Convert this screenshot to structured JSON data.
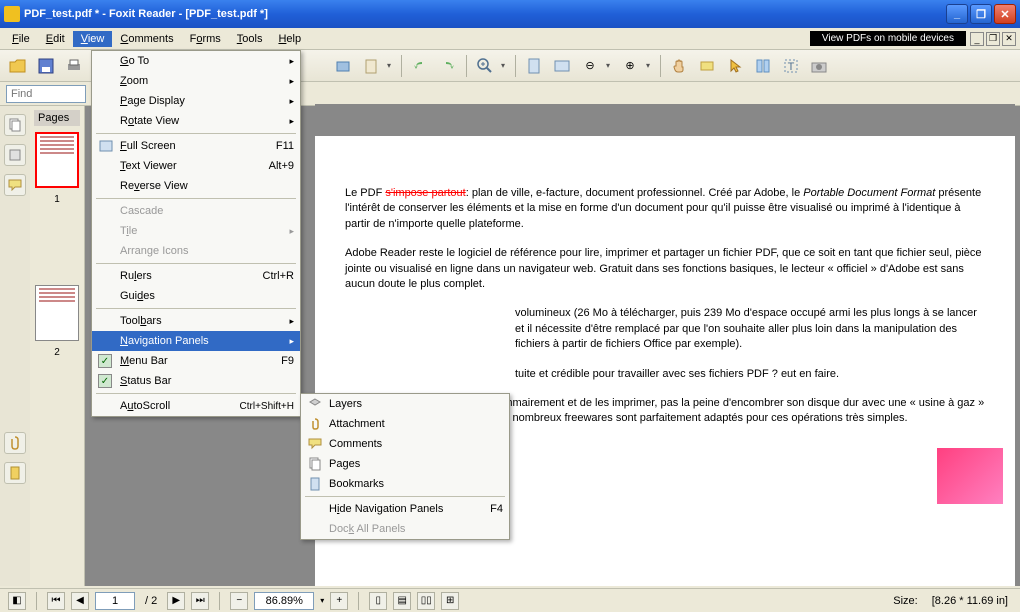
{
  "title": "PDF_test.pdf * - Foxit Reader - [PDF_test.pdf *]",
  "menu": {
    "file": "File",
    "edit": "Edit",
    "view": "View",
    "comments": "Comments",
    "forms": "Forms",
    "tools": "Tools",
    "help": "Help"
  },
  "ad": "View PDFs on mobile devices",
  "find_placeholder": "Find",
  "pages_label": "Pages",
  "view_menu": {
    "goto": "Go To",
    "zoom": "Zoom",
    "page_display": "Page Display",
    "rotate": "Rotate View",
    "fullscreen": "Full Screen",
    "fullscreen_sc": "F11",
    "textviewer": "Text Viewer",
    "textviewer_sc": "Alt+9",
    "reverse": "Reverse View",
    "cascade": "Cascade",
    "tile": "Tile",
    "arrange": "Arrange Icons",
    "rulers": "Rulers",
    "rulers_sc": "Ctrl+R",
    "guides": "Guides",
    "toolbars": "Toolbars",
    "navpanels": "Navigation Panels",
    "menubar": "Menu Bar",
    "menubar_sc": "F9",
    "statusbar": "Status Bar",
    "autoscroll": "AutoScroll",
    "autoscroll_sc": "Ctrl+Shift+H"
  },
  "submenu": {
    "layers": "Layers",
    "attachment": "Attachment",
    "comments": "Comments",
    "pages": "Pages",
    "bookmarks": "Bookmarks",
    "hide": "Hide Navigation Panels",
    "hide_sc": "F4",
    "dock": "Dock All Panels"
  },
  "thumbs": {
    "t1": "1",
    "t2": "2"
  },
  "doc": {
    "p1a": "Le PDF ",
    "p1strike": "s'impose partout",
    "p1b": ": plan de ville, e-facture, document professionnel. Créé par Adobe, le ",
    "p1italic": "Portable Document Format",
    "p1c": " présente l'intérêt de conserver les éléments et la mise en forme d'un document pour qu'il puisse être visualisé ou imprimé à l'identique à partir de n'importe quelle plateforme.",
    "p2": "Adobe Reader reste le logiciel de référence pour lire, imprimer et partager un fichier PDF, que ce soit en tant que fichier seul, pièce jointe ou visualisé en ligne dans un navigateur web. Gratuit dans ses fonctions basiques, le lecteur « officiel » d'Adobe est sans aucun doute le plus complet.",
    "p3": "volumineux (26 Mo à télécharger, puis 239 Mo d'espace occupé armi les plus longs à se lancer et il nécessite d'être remplacé par que l'on souhaite aller plus loin dans la manipulation des fichiers à partir de fichiers Office par exemple).",
    "p4": "tuite et crédible pour travailler avec ses fichiers PDF ? eut en faire.",
    "p5": "documents PDF, de les éditer sommairement et de les imprimer, pas la peine d'encombrer son disque dur avec une « usine à gaz » comme Adobe Reader car de très nombreux freewares sont parfaitement adaptés pour ces opérations très simples."
  },
  "status": {
    "page": "1",
    "total": "/ 2",
    "zoom": "86.89%",
    "size_label": "Size:",
    "size": "[8.26 * 11.69 in]"
  }
}
